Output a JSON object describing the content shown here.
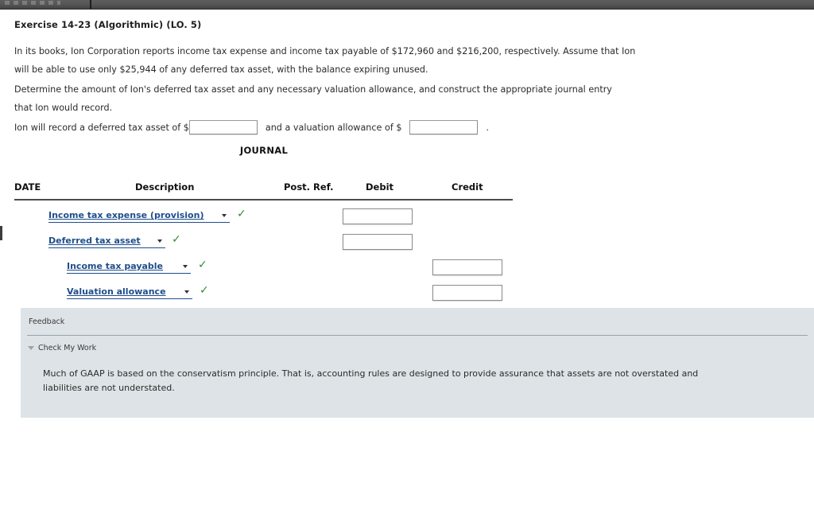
{
  "browser_chrome": {
    "present": true
  },
  "exercise": {
    "title": "Exercise 14-23 (Algorithmic) (LO. 5)",
    "paragraph_1": "In its books, Ion Corporation reports income tax expense and income tax payable of $172,960 and $216,200, respectively. Assume that Ion will be able to use only $25,944 of any deferred tax asset, with the balance expiring unused.",
    "paragraph_2": "Determine the amount of Ion's deferred tax asset and any necessary valuation allowance, and construct the appropriate journal entry that Ion would record."
  },
  "answer_line": {
    "text_before": "Ion will record a deferred tax asset of $",
    "deferred_tax_asset_value": "",
    "deferred_tax_asset_placeholder": "",
    "text_middle": "and a valuation allowance of $",
    "valuation_allowance_value": "",
    "valuation_allowance_placeholder": "",
    "text_after": "."
  },
  "journal": {
    "title": "JOURNAL",
    "columns": {
      "date": "DATE",
      "description": "Description",
      "post_ref": "Post. Ref.",
      "debit": "Debit",
      "credit": "Credit"
    },
    "rows": [
      {
        "account": "Income tax expense (provision)",
        "indent": 0,
        "validated": true,
        "check_mark": "✓",
        "amount_column": "debit",
        "amount_value": ""
      },
      {
        "account": "Deferred tax asset",
        "indent": 0,
        "validated": true,
        "check_mark": "✓",
        "amount_column": "debit",
        "amount_value": ""
      },
      {
        "account": "Income tax payable",
        "indent": 1,
        "validated": true,
        "check_mark": "✓",
        "amount_column": "credit",
        "amount_value": ""
      },
      {
        "account": "Valuation allowance",
        "indent": 1,
        "validated": true,
        "check_mark": "✓",
        "amount_column": "credit",
        "amount_value": ""
      }
    ]
  },
  "feedback": {
    "label": "Feedback",
    "check_my_work_label": "Check My Work",
    "body": "Much of GAAP is based on the conservatism principle. That is, accounting rules are designed to provide assurance that assets are not overstated and liabilities are not understated."
  },
  "colors": {
    "link_blue": "#1f4e8c",
    "check_green": "#2f8f2f",
    "feedback_bg": "#dde3e6",
    "rule_dark": "#4b4b4b"
  }
}
